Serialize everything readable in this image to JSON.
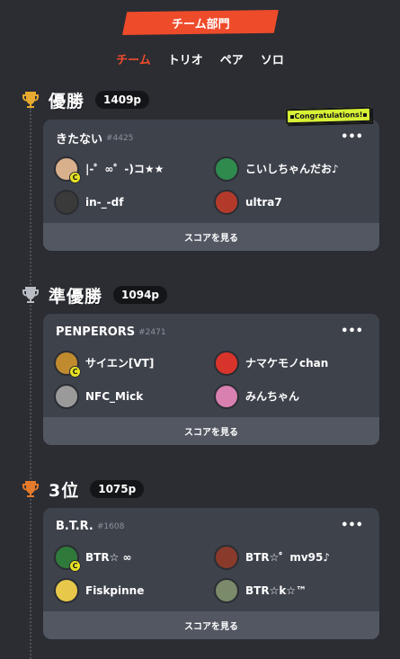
{
  "header": {
    "title": "チーム部門"
  },
  "tabs": [
    {
      "label": "チーム",
      "active": true
    },
    {
      "label": "トリオ",
      "active": false
    },
    {
      "label": "ペア",
      "active": false
    },
    {
      "label": "ソロ",
      "active": false
    }
  ],
  "congrats_label": "Congratulations!",
  "score_label": "スコアを見る",
  "more_label": "•••",
  "badge_letter": "C",
  "ranks": [
    {
      "title": "優勝",
      "trophy": "gold-trophy-icon",
      "trophy_color": "#e7a92f",
      "points": "1409p",
      "team": {
        "name": "きたない",
        "id": "#4425"
      },
      "members": [
        {
          "name": "|-゜∞゜-)コ★★",
          "captain": true,
          "avatar": "#d9b08c"
        },
        {
          "name": "こいしちゃんだお♪",
          "captain": false,
          "avatar": "#2f8a4e"
        },
        {
          "name": "in-_-df",
          "captain": false,
          "avatar": "#3a3a3a"
        },
        {
          "name": "ultra7",
          "captain": false,
          "avatar": "#b33a2b"
        }
      ]
    },
    {
      "title": "準優勝",
      "trophy": "silver-trophy-icon",
      "trophy_color": "#b9bcc2",
      "points": "1094p",
      "team": {
        "name": "PENPERORS",
        "id": "#2471"
      },
      "members": [
        {
          "name": "サイエン[VT]",
          "captain": true,
          "avatar": "#c08a2f"
        },
        {
          "name": "ナマケモノchan",
          "captain": false,
          "avatar": "#d9342b"
        },
        {
          "name": "NFC_Mick",
          "captain": false,
          "avatar": "#9a9a9a"
        },
        {
          "name": "みんちゃん",
          "captain": false,
          "avatar": "#d880b0"
        }
      ]
    },
    {
      "title": "3位",
      "trophy": "bronze-trophy-icon",
      "trophy_color": "#e57a2a",
      "points": "1075p",
      "team": {
        "name": "B.T.R.",
        "id": "#1608"
      },
      "members": [
        {
          "name": "BTR☆ ∞",
          "captain": true,
          "avatar": "#2f7a3a"
        },
        {
          "name": "BTR☆゜mv95♪",
          "captain": false,
          "avatar": "#8a3a2a"
        },
        {
          "name": "Fiskpinne",
          "captain": false,
          "avatar": "#e8c84a"
        },
        {
          "name": "BTR☆k☆™",
          "captain": false,
          "avatar": "#7a8a6a"
        }
      ]
    }
  ]
}
